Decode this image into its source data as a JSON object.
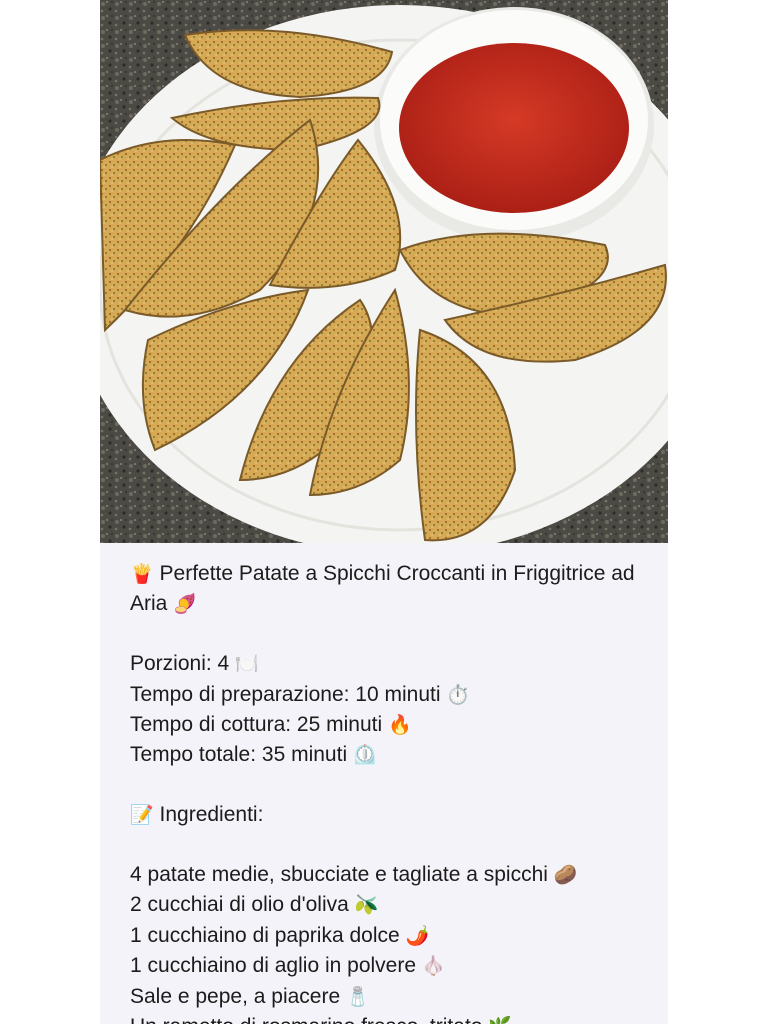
{
  "post": {
    "image": {
      "alt": "",
      "colors": {
        "plate": "#f4f4f2",
        "sauce": "#c0261a",
        "counter": "#4c4a44",
        "potato": "#d9ae5c"
      }
    },
    "title": {
      "icon": "🍟",
      "text": "Perfette Patate a Spicchi Croccanti in Friggitrice ad Aria",
      "icon_end": "🍠"
    },
    "meta": [
      {
        "label": "Porzioni: 4",
        "icon": "🍽️"
      },
      {
        "label": "Tempo di preparazione: 10 minuti",
        "icon": "⏱️"
      },
      {
        "label": "Tempo di cottura: 25 minuti",
        "icon": "🔥"
      },
      {
        "label": "Tempo totale: 35 minuti",
        "icon": "⏲️"
      }
    ],
    "ingredients_heading": {
      "icon": "📝",
      "text": "Ingredienti:"
    },
    "ingredients": [
      {
        "text": "4 patate medie, sbucciate e tagliate a spicchi",
        "icon": "🥔"
      },
      {
        "text": "2 cucchiai di olio d'oliva",
        "icon": "🫒"
      },
      {
        "text": "1 cucchiaino di paprika dolce",
        "icon": "🌶️"
      },
      {
        "text": "1 cucchiaino di aglio in polvere",
        "icon": "🧄"
      },
      {
        "text": "Sale e pepe, a piacere",
        "icon": "🧂"
      },
      {
        "text": "Un rametto di rosmarino fresco, tritato",
        "icon": "🌿"
      }
    ]
  }
}
